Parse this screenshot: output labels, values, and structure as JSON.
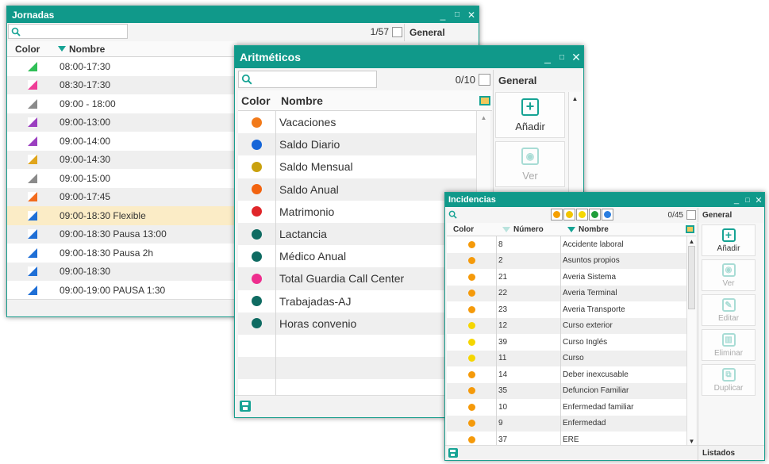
{
  "jornadas": {
    "title": "Jornadas",
    "pager": "1/57",
    "side_tab": "General",
    "col_color": "Color",
    "col_name": "Nombre",
    "rows": [
      {
        "name": "08:00-17:30",
        "color": "#2fbf57"
      },
      {
        "name": "08:30-17:30",
        "color": "#ef3d97"
      },
      {
        "name": "09:00 - 18:00",
        "color": "#8a8a8a"
      },
      {
        "name": "09:00-13:00",
        "color": "#9b3fc0"
      },
      {
        "name": "09:00-14:00",
        "color": "#9b3fc0"
      },
      {
        "name": "09:00-14:30",
        "color": "#e0a51c"
      },
      {
        "name": "09:00-15:00",
        "color": "#8a8a8a"
      },
      {
        "name": "09:00-17:45",
        "color": "#f26b1d"
      },
      {
        "name": "09:00-18:30 Flexible",
        "color": "#1f6fd6"
      },
      {
        "name": "09:00-18:30 Pausa 13:00",
        "color": "#1f6fd6"
      },
      {
        "name": "09:00-18:30 Pausa 2h",
        "color": "#1f6fd6"
      },
      {
        "name": "09:00-18:30",
        "color": "#1f6fd6"
      },
      {
        "name": "09:00-19:00 PAUSA 1:30",
        "color": "#1f6fd6"
      }
    ]
  },
  "aritmeticos": {
    "title": "Aritméticos",
    "pager": "0/10",
    "side_tab": "General",
    "col_color": "Color",
    "col_name": "Nombre",
    "add_label": "Añadir",
    "view_label": "Ver",
    "rows": [
      {
        "name": "Vacaciones",
        "color": "#f27a1a"
      },
      {
        "name": "Saldo Diario",
        "color": "#1565d8"
      },
      {
        "name": "Saldo Mensual",
        "color": "#c9a10e"
      },
      {
        "name": "Saldo Anual",
        "color": "#f2630f"
      },
      {
        "name": "Matrimonio",
        "color": "#e0262a"
      },
      {
        "name": "Lactancia",
        "color": "#0f6b62"
      },
      {
        "name": "Médico Anual",
        "color": "#0f6b62"
      },
      {
        "name": "Total Guardia Call Center",
        "color": "#ee2e8e"
      },
      {
        "name": "Trabajadas-AJ",
        "color": "#0f6b62"
      },
      {
        "name": "Horas convenio",
        "color": "#0f6b62"
      }
    ]
  },
  "incidencias": {
    "title": "Incidencias",
    "pager": "0/45",
    "side_tab": "General",
    "col_color": "Color",
    "col_number": "Número",
    "col_name": "Nombre",
    "filter_colors": [
      "#f5a000",
      "#f2c500",
      "#f5d800",
      "#1f9e3a",
      "#2a7ee0"
    ],
    "buttons": {
      "add": "Añadir",
      "view": "Ver",
      "edit": "Editar",
      "delete": "Eliminar",
      "duplicate": "Duplicar"
    },
    "footer_tab": "Listados",
    "rows": [
      {
        "num": "8",
        "name": "Accidente laboral",
        "color": "#f59a0a"
      },
      {
        "num": "2",
        "name": "Asuntos propios",
        "color": "#f59a0a"
      },
      {
        "num": "21",
        "name": "Averia Sistema",
        "color": "#f59a0a"
      },
      {
        "num": "22",
        "name": "Averia Terminal",
        "color": "#f59a0a"
      },
      {
        "num": "23",
        "name": "Averia Transporte",
        "color": "#f59a0a"
      },
      {
        "num": "12",
        "name": "Curso exterior",
        "color": "#f5d600"
      },
      {
        "num": "39",
        "name": "Curso Inglés",
        "color": "#f5d600"
      },
      {
        "num": "11",
        "name": "Curso",
        "color": "#f5d600"
      },
      {
        "num": "14",
        "name": "Deber inexcusable",
        "color": "#f59a0a"
      },
      {
        "num": "35",
        "name": "Defuncion Familiar",
        "color": "#f59a0a"
      },
      {
        "num": "10",
        "name": "Enfermedad familiar",
        "color": "#f59a0a"
      },
      {
        "num": "9",
        "name": "Enfermedad",
        "color": "#f59a0a"
      },
      {
        "num": "37",
        "name": "ERE",
        "color": "#f59a0a"
      }
    ]
  },
  "icons": {
    "search": "search-icon",
    "minimize": "minimize-icon",
    "maximize": "maximize-icon",
    "close": "close-icon",
    "save": "save-icon",
    "columns": "columns-icon"
  },
  "accent": "#10998a"
}
